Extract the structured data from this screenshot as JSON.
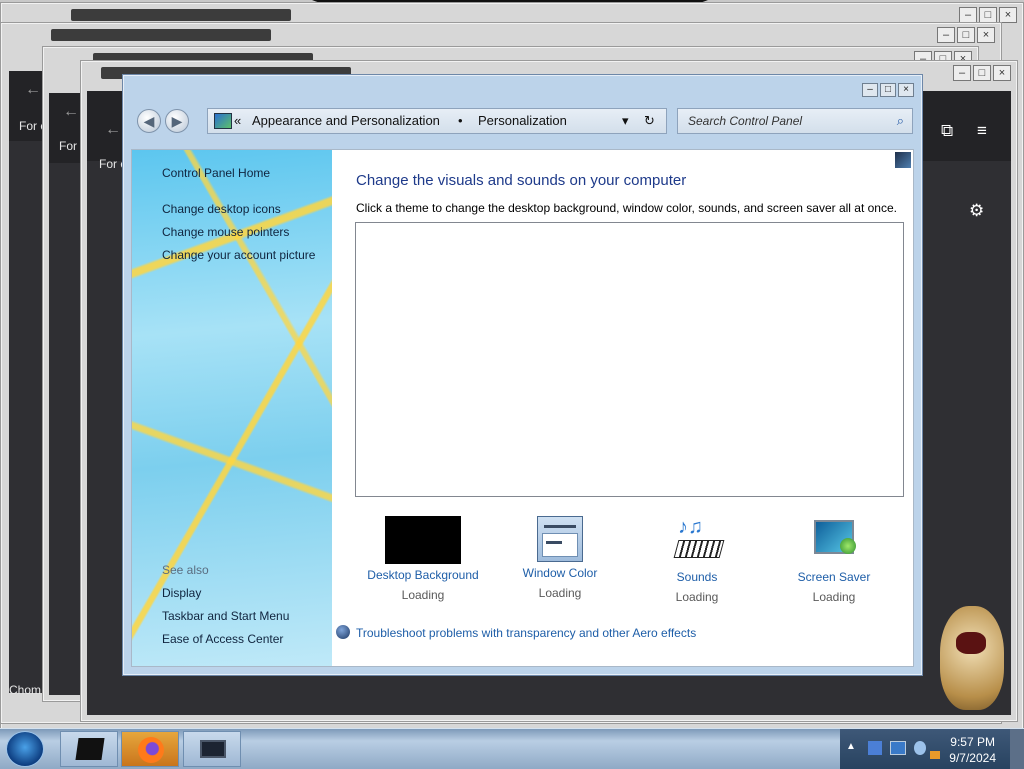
{
  "background": {
    "desktop_color": "#6a0f6f",
    "accent_red": "#c0202a"
  },
  "stacked_windows": [
    {
      "text": "For c",
      "bottom_text": "Chom"
    },
    {
      "text": "For"
    },
    {
      "text": "For c"
    }
  ],
  "window": {
    "controls": {
      "minimize": "–",
      "maximize": "□",
      "close": "×"
    },
    "nav": {
      "back_icon": "back-arrow-icon",
      "forward_icon": "forward-arrow-icon",
      "chevrons": "«",
      "breadcrumb_parent": "Appearance and Personalization",
      "separator": "•",
      "breadcrumb_current": "Personalization",
      "dropdown_icon": "▾",
      "refresh_icon": "↻",
      "search_placeholder": "Search Control Panel",
      "search_icon": "magnifier-icon"
    },
    "sidebar": {
      "home": "Control Panel Home",
      "links": [
        "Change desktop icons",
        "Change mouse pointers",
        "Change your account picture"
      ],
      "see_also_heading": "See also",
      "see_also": [
        "Display",
        "Taskbar and Start Menu",
        "Ease of Access Center"
      ]
    },
    "main": {
      "title": "Change the visuals and sounds on your computer",
      "subtitle": "Click a theme to change the desktop background, window color, sounds, and screen saver all at once.",
      "tiles": [
        {
          "label": "Desktop Background",
          "status": "Loading",
          "icon": "desktop-background-icon"
        },
        {
          "label": "Window Color",
          "status": "Loading",
          "icon": "window-color-icon"
        },
        {
          "label": "Sounds",
          "status": "Loading",
          "icon": "sounds-icon"
        },
        {
          "label": "Screen Saver",
          "status": "Loading",
          "icon": "screen-saver-icon"
        }
      ],
      "troubleshoot": "Troubleshoot problems with transparency and other Aero effects"
    }
  },
  "taskbar": {
    "time": "9:57 PM",
    "date": "9/7/2024",
    "pinned": [
      "terminal-icon",
      "firefox-icon",
      "display-icon"
    ]
  }
}
